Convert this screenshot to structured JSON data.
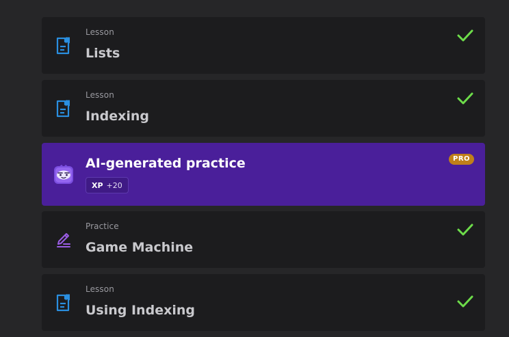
{
  "items": [
    {
      "kind": "Lesson",
      "title": "Lists",
      "icon": "lesson-document-icon",
      "completed": true
    },
    {
      "kind": "Lesson",
      "title": "Indexing",
      "icon": "lesson-document-icon",
      "completed": true
    },
    {
      "kind": "",
      "title": "AI-generated practice",
      "icon": "ai-mascot-icon",
      "badge": "PRO",
      "xp_label": "XP",
      "xp_value": "+20",
      "completed": false
    },
    {
      "kind": "Practice",
      "title": "Game Machine",
      "icon": "pencil-icon",
      "completed": true
    },
    {
      "kind": "Lesson",
      "title": "Using Indexing",
      "icon": "lesson-document-icon",
      "completed": true
    }
  ],
  "colors": {
    "background": "#262628",
    "card": "#1c1c1e",
    "pro_card": "#4a1f9a",
    "check": "#6ddc4a",
    "lesson_icon": "#2a8fe0",
    "practice_icon": "#9b5de5",
    "badge": "#c08019"
  }
}
